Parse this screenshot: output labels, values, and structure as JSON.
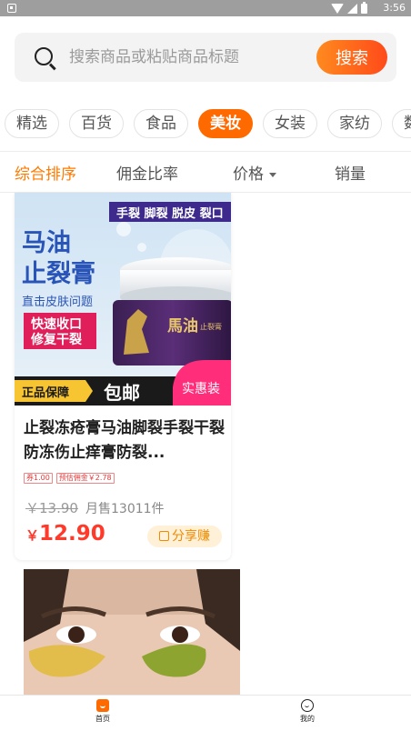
{
  "status_bar": {
    "time": "3:56"
  },
  "search": {
    "placeholder": "搜索商品或粘贴商品标题",
    "button_label": "搜索"
  },
  "categories": [
    "精选",
    "百货",
    "食品",
    "美妆",
    "女装",
    "家纺",
    "数"
  ],
  "active_category": "美妆",
  "sort_options": {
    "default": "综合排序",
    "commission": "佣金比率",
    "price": "价格",
    "sales": "销量"
  },
  "product": {
    "image_text": {
      "top_banner": "手裂 脚裂 脱皮 裂口",
      "name_line1": "马油",
      "name_line2": "止裂膏",
      "subtitle": "直击皮肤问题",
      "feature1": "快速收口",
      "feature2": "修复干裂",
      "jar_label": "馬油",
      "jar_label_small": "止裂膏",
      "guarantee": "正品保障",
      "free_ship": "包邮",
      "real_pack": "实惠装"
    },
    "title": "止裂冻疮膏马油脚裂手裂干裂防冻伤止痒膏防裂...",
    "coupon_tag": "券1.00",
    "commission_tag": "预估佣金￥2.78",
    "original_price": "￥13.90",
    "monthly_sales": "月售13011件",
    "currency": "￥",
    "price": "12.90",
    "share_label": "分享赚"
  },
  "bottom_nav": {
    "home_label": "首页",
    "me_label": "我的"
  },
  "colors": {
    "accent": "#ff6a00",
    "price": "#ff3a2a"
  }
}
